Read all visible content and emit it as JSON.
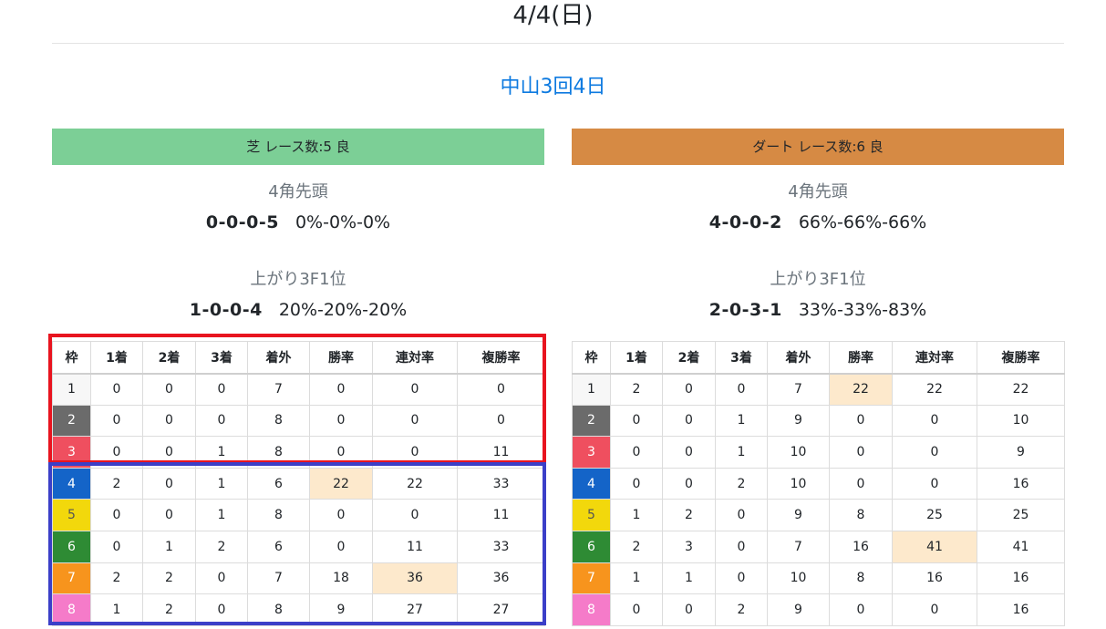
{
  "header": {
    "date": "4/4(日)",
    "meeting": "中山3回4日"
  },
  "colors": {
    "turf_band": "#7ccf96",
    "dirt_band": "#d68a44",
    "link": "#0d7ae0",
    "highlight_cell": "#fde9cc",
    "red_box": "#e8141f",
    "blue_box": "#3b3fc8"
  },
  "waku_colors": [
    {
      "bg": "#f7f7f7",
      "fg": "#212529"
    },
    {
      "bg": "#6b6b6b",
      "fg": "#ffffff"
    },
    {
      "bg": "#ef4f5f",
      "fg": "#ffffff"
    },
    {
      "bg": "#1464c8",
      "fg": "#ffffff"
    },
    {
      "bg": "#f2d80c",
      "fg": "#555555"
    },
    {
      "bg": "#2e8b34",
      "fg": "#ffffff"
    },
    {
      "bg": "#f7941d",
      "fg": "#ffffff"
    },
    {
      "bg": "#f57bc9",
      "fg": "#ffffff"
    }
  ],
  "columns": [
    "枠",
    "1着",
    "2着",
    "3着",
    "着外",
    "勝率",
    "連対率",
    "複勝率"
  ],
  "turf": {
    "band": "芝 レース数:5 良",
    "corner_label": "4角先頭",
    "corner_record": "0-0-0-5",
    "corner_pct": "0%-0%-0%",
    "last3f_label": "上がり3F1位",
    "last3f_record": "1-0-0-4",
    "last3f_pct": "20%-20%-20%",
    "rows": [
      {
        "waku": "1",
        "cells": [
          "0",
          "0",
          "0",
          "7",
          "0",
          "0",
          "0"
        ],
        "hl": []
      },
      {
        "waku": "2",
        "cells": [
          "0",
          "0",
          "0",
          "8",
          "0",
          "0",
          "0"
        ],
        "hl": []
      },
      {
        "waku": "3",
        "cells": [
          "0",
          "0",
          "1",
          "8",
          "0",
          "0",
          "11"
        ],
        "hl": []
      },
      {
        "waku": "4",
        "cells": [
          "2",
          "0",
          "1",
          "6",
          "22",
          "22",
          "33"
        ],
        "hl": [
          4
        ]
      },
      {
        "waku": "5",
        "cells": [
          "0",
          "0",
          "1",
          "8",
          "0",
          "0",
          "11"
        ],
        "hl": []
      },
      {
        "waku": "6",
        "cells": [
          "0",
          "1",
          "2",
          "6",
          "0",
          "11",
          "33"
        ],
        "hl": []
      },
      {
        "waku": "7",
        "cells": [
          "2",
          "2",
          "0",
          "7",
          "18",
          "36",
          "36"
        ],
        "hl": [
          5
        ]
      },
      {
        "waku": "8",
        "cells": [
          "1",
          "2",
          "0",
          "8",
          "9",
          "27",
          "27"
        ],
        "hl": []
      }
    ]
  },
  "dirt": {
    "band": "ダート レース数:6 良",
    "corner_label": "4角先頭",
    "corner_record": "4-0-0-2",
    "corner_pct": "66%-66%-66%",
    "last3f_label": "上がり3F1位",
    "last3f_record": "2-0-3-1",
    "last3f_pct": "33%-33%-83%",
    "rows": [
      {
        "waku": "1",
        "cells": [
          "2",
          "0",
          "0",
          "7",
          "22",
          "22",
          "22"
        ],
        "hl": [
          4
        ]
      },
      {
        "waku": "2",
        "cells": [
          "0",
          "0",
          "1",
          "9",
          "0",
          "0",
          "10"
        ],
        "hl": []
      },
      {
        "waku": "3",
        "cells": [
          "0",
          "0",
          "1",
          "10",
          "0",
          "0",
          "9"
        ],
        "hl": []
      },
      {
        "waku": "4",
        "cells": [
          "0",
          "0",
          "2",
          "10",
          "0",
          "0",
          "16"
        ],
        "hl": []
      },
      {
        "waku": "5",
        "cells": [
          "1",
          "2",
          "0",
          "9",
          "8",
          "25",
          "25"
        ],
        "hl": []
      },
      {
        "waku": "6",
        "cells": [
          "2",
          "3",
          "0",
          "7",
          "16",
          "41",
          "41"
        ],
        "hl": [
          5
        ]
      },
      {
        "waku": "7",
        "cells": [
          "1",
          "1",
          "0",
          "10",
          "8",
          "16",
          "16"
        ],
        "hl": []
      },
      {
        "waku": "8",
        "cells": [
          "0",
          "0",
          "2",
          "9",
          "0",
          "0",
          "16"
        ],
        "hl": []
      }
    ]
  }
}
